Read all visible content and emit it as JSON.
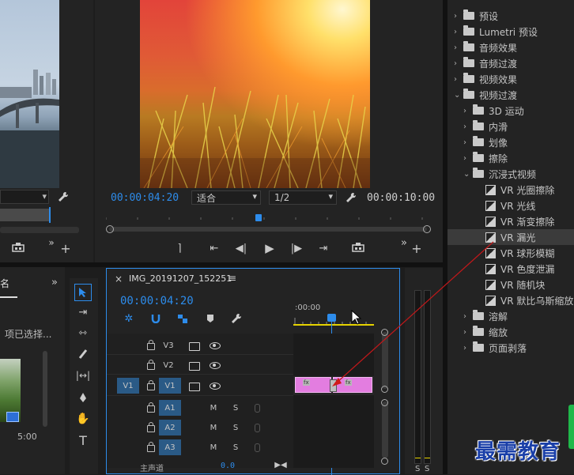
{
  "source_monitor": {
    "hidden_label": "",
    "dropdown_arrow": "▾"
  },
  "program_monitor": {
    "current_timecode": "00:00:04:20",
    "fit_label": "适合",
    "resolution_label": "1/2",
    "duration_timecode": "00:00:10:00"
  },
  "project_panel": {
    "tab_fragment": "名",
    "selection_text": "项已选择...",
    "clip_duration": "5:00"
  },
  "effects_panel": {
    "items": [
      {
        "type": "folder",
        "label": "预设",
        "level": 0,
        "expanded": false
      },
      {
        "type": "folder",
        "label": "Lumetri 预设",
        "level": 0,
        "expanded": false
      },
      {
        "type": "folder",
        "label": "音频效果",
        "level": 0,
        "expanded": false
      },
      {
        "type": "folder",
        "label": "音频过渡",
        "level": 0,
        "expanded": false
      },
      {
        "type": "folder",
        "label": "视频效果",
        "level": 0,
        "expanded": false
      },
      {
        "type": "folder",
        "label": "视频过渡",
        "level": 0,
        "expanded": true
      },
      {
        "type": "folder",
        "label": "3D 运动",
        "level": 1,
        "expanded": false
      },
      {
        "type": "folder",
        "label": "内滑",
        "level": 1,
        "expanded": false
      },
      {
        "type": "folder",
        "label": "划像",
        "level": 1,
        "expanded": false
      },
      {
        "type": "folder",
        "label": "擦除",
        "level": 1,
        "expanded": false
      },
      {
        "type": "folder",
        "label": "沉浸式视频",
        "level": 1,
        "expanded": true
      },
      {
        "type": "effect",
        "label": "VR 光圈擦除",
        "level": 2
      },
      {
        "type": "effect",
        "label": "VR 光线",
        "level": 2
      },
      {
        "type": "effect",
        "label": "VR 渐变擦除",
        "level": 2
      },
      {
        "type": "effect",
        "label": "VR 漏光",
        "level": 2,
        "selected": true
      },
      {
        "type": "effect",
        "label": "VR 球形模糊",
        "level": 2
      },
      {
        "type": "effect",
        "label": "VR 色度泄漏",
        "level": 2
      },
      {
        "type": "effect",
        "label": "VR 随机块",
        "level": 2
      },
      {
        "type": "effect",
        "label": "VR 默比乌斯缩放",
        "level": 2
      },
      {
        "type": "folder",
        "label": "溶解",
        "level": 1,
        "expanded": false
      },
      {
        "type": "folder",
        "label": "缩放",
        "level": 1,
        "expanded": false
      },
      {
        "type": "folder",
        "label": "页面剥落",
        "level": 1,
        "expanded": false
      }
    ]
  },
  "timeline": {
    "sequence_name": "IMG_20191207_152251",
    "close_glyph": "×",
    "menu_glyph": "≡",
    "timecode": "00:00:04:20",
    "ruler_start": ":00:00",
    "source_patch_v1": "V1",
    "video_tracks": [
      "V3",
      "V2",
      "V1"
    ],
    "audio_tracks": [
      "A1",
      "A2",
      "A3"
    ],
    "mute_label": "M",
    "solo_label": "S",
    "master_label": "主声道",
    "master_value": "0.0",
    "fx_badge": "fx"
  },
  "meter": {
    "s_labels": [
      "S",
      "S"
    ]
  },
  "watermark": "最需教育",
  "colors": {
    "accent_blue": "#2d8ceb",
    "clip_pink": "#e37de0",
    "selection_red": "#d11a1a",
    "ruler_yellow": "#e5d200"
  }
}
